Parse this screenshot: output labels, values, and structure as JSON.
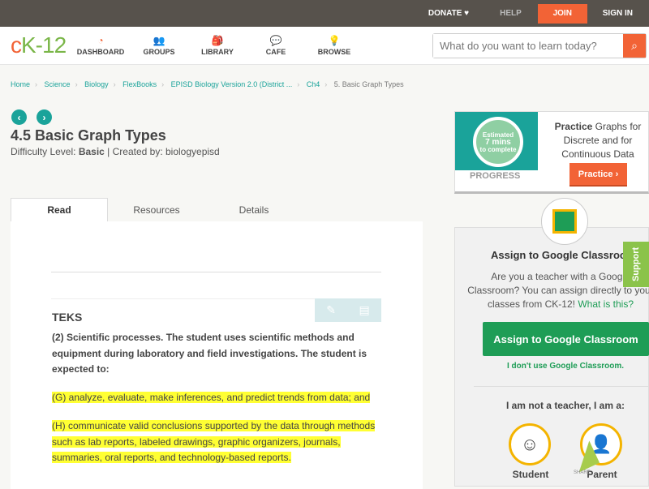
{
  "topbar": {
    "donate": "DONATE ♥",
    "help": "HELP",
    "join": "JOIN",
    "signin": "SIGN IN"
  },
  "nav": {
    "logo_c": "c",
    "logo_k": "K-12",
    "items": [
      {
        "label": "DASHBOARD",
        "icon": "◔"
      },
      {
        "label": "GROUPS",
        "icon": "👥"
      },
      {
        "label": "LIBRARY",
        "icon": "🎒"
      },
      {
        "label": "CAFE",
        "icon": "💬"
      },
      {
        "label": "BROWSE",
        "icon": "💡"
      }
    ]
  },
  "search": {
    "placeholder": "What do you want to learn today?",
    "icon": "⌕"
  },
  "breadcrumb": [
    "Home",
    "Science",
    "Biology",
    "FlexBooks",
    "EPISD Biology Version 2.0 (District ...",
    "Ch4",
    "5. Basic Graph Types"
  ],
  "breadcrumb_sep": "›",
  "page": {
    "prev": "‹",
    "next": "›",
    "title": "4.5 Basic Graph Types",
    "difficulty_label": "Difficulty Level: ",
    "difficulty": "Basic",
    "created": " | Created by: biologyepisd"
  },
  "tabs": [
    "Read",
    "Resources",
    "Details"
  ],
  "content": {
    "heading": "TEKS",
    "tool_edit": "✎",
    "tool_notes": "▤",
    "p1": "(2)  Scientific processes. The student uses scientific methods and equipment during laboratory and field investigations. The student is expected to:",
    "p2": "(G)  analyze, evaluate, make inferences, and predict trends from data; and",
    "p3": "(H)  communicate valid conclusions supported by the data through methods such as lab reports, labeled drawings, graphic organizers, journals, summaries, oral reports, and technology-based reports."
  },
  "practice": {
    "est1": "Estimated",
    "est2": "7 mins",
    "est3": "to complete",
    "progress": "PROGRESS",
    "bold": "Practice",
    "text": " Graphs for Discrete and for Continuous Data",
    "button": "Practice ›"
  },
  "classroom": {
    "title": "Assign to Google Classroom",
    "desc1": "Are you a teacher with a Google",
    "desc2": "Classroom? You can assign directly to your",
    "desc3": "classes from CK-12! ",
    "link": "What is this?",
    "button": "Assign to Google Classroom",
    "no": "I don't use Google Classroom.",
    "not_teacher": "I am not a teacher, I am a:",
    "roles": [
      {
        "label": "Student",
        "icon": "☺"
      },
      {
        "label": "Parent",
        "icon": "👤"
      }
    ]
  },
  "support": "Support",
  "share": "SHARE"
}
